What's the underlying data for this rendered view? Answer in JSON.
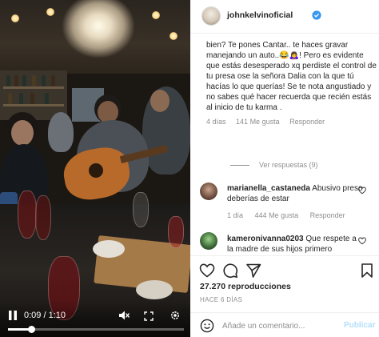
{
  "video": {
    "time": "0:09 / 1:10",
    "progress": 0.13,
    "icons": {
      "play": "play-icon",
      "mute": "mute-icon",
      "fullscreen": "fullscreen-icon",
      "settings": "settings-icon"
    }
  },
  "header": {
    "username": "johnkelvinoficial",
    "verified_icon": "verified-icon",
    "accent": "#3897f0"
  },
  "main_comment": {
    "text": "bien? Te pones Cantar.. te haces gravar manejando un auto..😂🙇‍♀️! Pero es evidente que estás desesperado xq perdiste el control de tu presa ose la señora Dalia con la que tú hacías lo que querías! Se te nota angustiado y no sabes qué hacer recuerda que recién estás al inicio de tu karma .",
    "time": "4 días",
    "likes": "141 Me gusta",
    "reply": "Responder",
    "view_replies": "Ver respuestas (9)"
  },
  "comments": [
    {
      "username": "marianella_castaneda",
      "text": "Abusivo preso deberías de estar",
      "time": "1 día",
      "likes": "444 Me gusta",
      "reply": "Responder"
    },
    {
      "username": "kameronivanna0203",
      "text": "Que respete a la madre de sus hijos primero",
      "time": "",
      "likes": "",
      "reply": ""
    }
  ],
  "actions": {
    "icons": [
      "heart-icon",
      "comment-icon",
      "share-icon",
      "bookmark-icon"
    ],
    "views": "27.270 reproducciones",
    "date": "HACE 6 DÍAS"
  },
  "add_comment": {
    "emoji_icon": "emoji-icon",
    "placeholder": "Añade un comentario...",
    "publish_label": "Publicar",
    "publish_color": "#b2dffc"
  }
}
